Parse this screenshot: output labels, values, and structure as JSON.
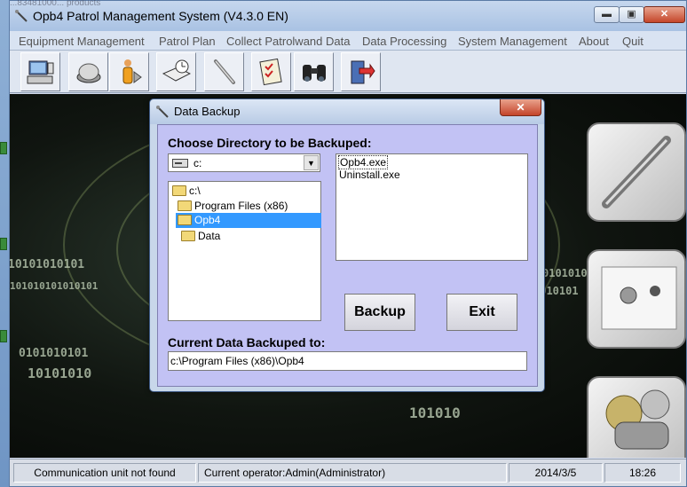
{
  "window": {
    "title": "Opb4  Patrol Management System (V4.3.0 EN)",
    "background_text": "...83481000...   products"
  },
  "window_controls": {
    "minimize": "▬",
    "maximize": "▣",
    "close": "✕"
  },
  "menu": {
    "items": [
      "Equipment Management",
      "Patrol Plan",
      "Collect Patrolwand Data",
      "Data Processing",
      "System Management",
      "About",
      "Quit"
    ]
  },
  "toolbar": {
    "icons": [
      "computer-icon",
      "reader-button-icon",
      "person-icon",
      "book-clock-icon",
      "patrol-wand-icon",
      "checklist-icon",
      "binoculars-icon",
      "exit-door-icon"
    ]
  },
  "workspace": {
    "binary_lines": [
      "10101010101",
      "101010101010101",
      "0101010101",
      "10101010",
      "101010",
      "0101010",
      "1010101"
    ]
  },
  "dialog": {
    "title": "Data Backup",
    "close_label": "✕",
    "choose_dir_label": "Choose Directory to be Backuped:",
    "drive_value": "c:",
    "tree": [
      "c:\\",
      "Program Files (x86)",
      "Opb4",
      "Data"
    ],
    "selected_tree_index": 2,
    "files": [
      "Opb4.exe",
      "Uninstall.exe"
    ],
    "backup_button": "Backup",
    "exit_button": "Exit",
    "current_label": "Current Data Backuped to:",
    "current_path": "c:\\Program Files (x86)\\Opb4"
  },
  "status": {
    "comm": "Communication unit not found",
    "operator": "Current operator:Admin(Administrator)",
    "date": "2014/3/5",
    "time": "18:26"
  },
  "colors": {
    "dialog_body": "#c2c2f4",
    "selection": "#3399ff",
    "close_button": "#c4432a"
  }
}
